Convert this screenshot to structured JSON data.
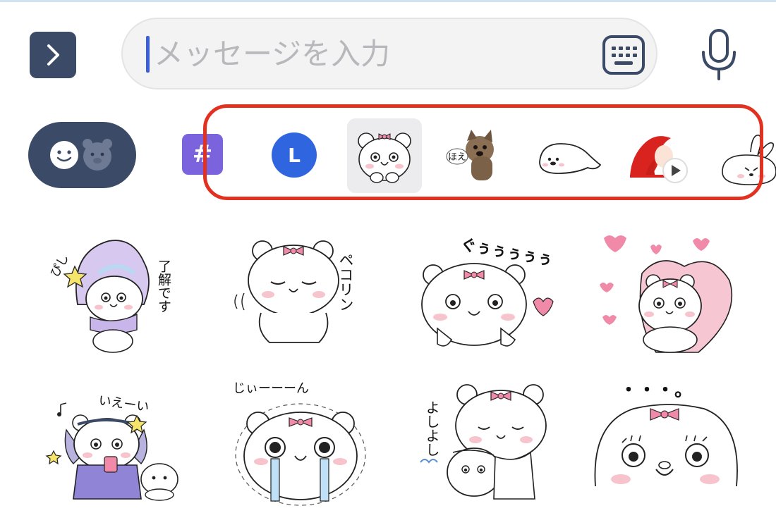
{
  "input_bar": {
    "expand_icon": "chevron-right-icon",
    "placeholder": "メッセージを入力",
    "keyboard_icon": "keyboard-icon",
    "mic_icon": "microphone-icon"
  },
  "tab_row": {
    "type_toggle_icons": [
      "emoji-face-icon",
      "bear-face-icon"
    ],
    "tabs": [
      {
        "id": "hashtag",
        "label": "#"
      },
      {
        "id": "line-official",
        "label": "L"
      },
      {
        "id": "bear-with-bow",
        "selected": true
      },
      {
        "id": "dog-photo",
        "label": "ほえ"
      },
      {
        "id": "seal"
      },
      {
        "id": "mermaid",
        "badge": "play-icon"
      },
      {
        "id": "rabbit"
      }
    ],
    "highlight_color": "#e33121"
  },
  "stickers": [
    {
      "id": "sticker-1",
      "texts": [
        "ぴし",
        "了解です"
      ]
    },
    {
      "id": "sticker-2",
      "texts": [
        "ペコリン"
      ]
    },
    {
      "id": "sticker-3",
      "texts": [
        "ぐぅぅぅぅぅ"
      ]
    },
    {
      "id": "sticker-4",
      "texts": []
    },
    {
      "id": "sticker-5",
      "texts": [
        "いえーい"
      ]
    },
    {
      "id": "sticker-6",
      "texts": [
        "じぃーーーん"
      ]
    },
    {
      "id": "sticker-7",
      "texts": [
        "よしよし"
      ]
    },
    {
      "id": "sticker-8",
      "texts": [
        "・・・。"
      ]
    }
  ],
  "colors": {
    "dark_navy": "#3b4a66",
    "bow_pink": "#f08aa8",
    "blush": "#f7c3cc",
    "hashtag_purple": "#7a63dc",
    "line_blue": "#2f66e0"
  }
}
